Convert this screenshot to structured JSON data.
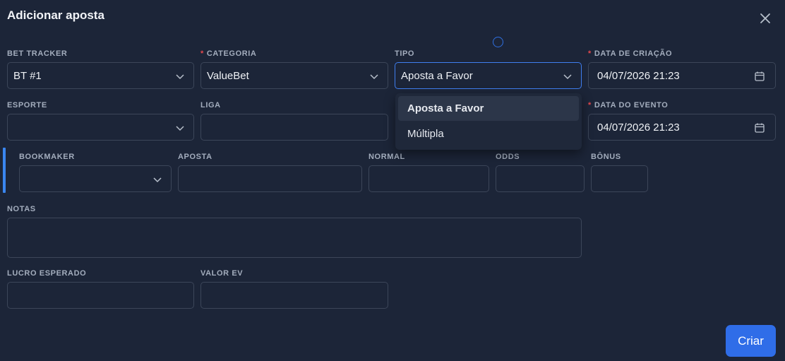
{
  "dialog": {
    "title": "Adicionar aposta"
  },
  "fields": {
    "bet_tracker": {
      "label": "BET TRACKER",
      "value": "BT #1"
    },
    "categoria": {
      "label": "CATEGORIA",
      "value": "ValueBet",
      "required": "*"
    },
    "tipo": {
      "label": "TIPO",
      "value": "Aposta a Favor"
    },
    "data_criacao": {
      "label": "DATA DE CRIAÇÃO",
      "value": "04/07/2026 21:23",
      "required": "*"
    },
    "esporte": {
      "label": "ESPORTE",
      "value": ""
    },
    "liga": {
      "label": "LIGA",
      "value": ""
    },
    "data_evento": {
      "label": "DATA DO EVENTO",
      "value": "04/07/2026 21:23",
      "required": "*"
    },
    "bookmaker": {
      "label": "BOOKMAKER",
      "value": ""
    },
    "aposta": {
      "label": "APOSTA",
      "value": ""
    },
    "normal": {
      "label": "NORMAL",
      "value": ""
    },
    "odds": {
      "label": "ODDS",
      "value": ""
    },
    "bonus": {
      "label": "BÔNUS",
      "value": ""
    },
    "notas": {
      "label": "NOTAS",
      "value": ""
    },
    "lucro_esperado": {
      "label": "LUCRO ESPERADO",
      "value": ""
    },
    "valor_ev": {
      "label": "VALOR EV",
      "value": ""
    }
  },
  "tipo_dropdown": {
    "options": [
      {
        "label": "Aposta a Favor",
        "selected": true
      },
      {
        "label": "Múltipla",
        "selected": false
      }
    ]
  },
  "actions": {
    "submit_label": "Criar"
  },
  "colors": {
    "background": "#1c2538",
    "accent": "#2f6de8",
    "required": "#e5484d"
  }
}
